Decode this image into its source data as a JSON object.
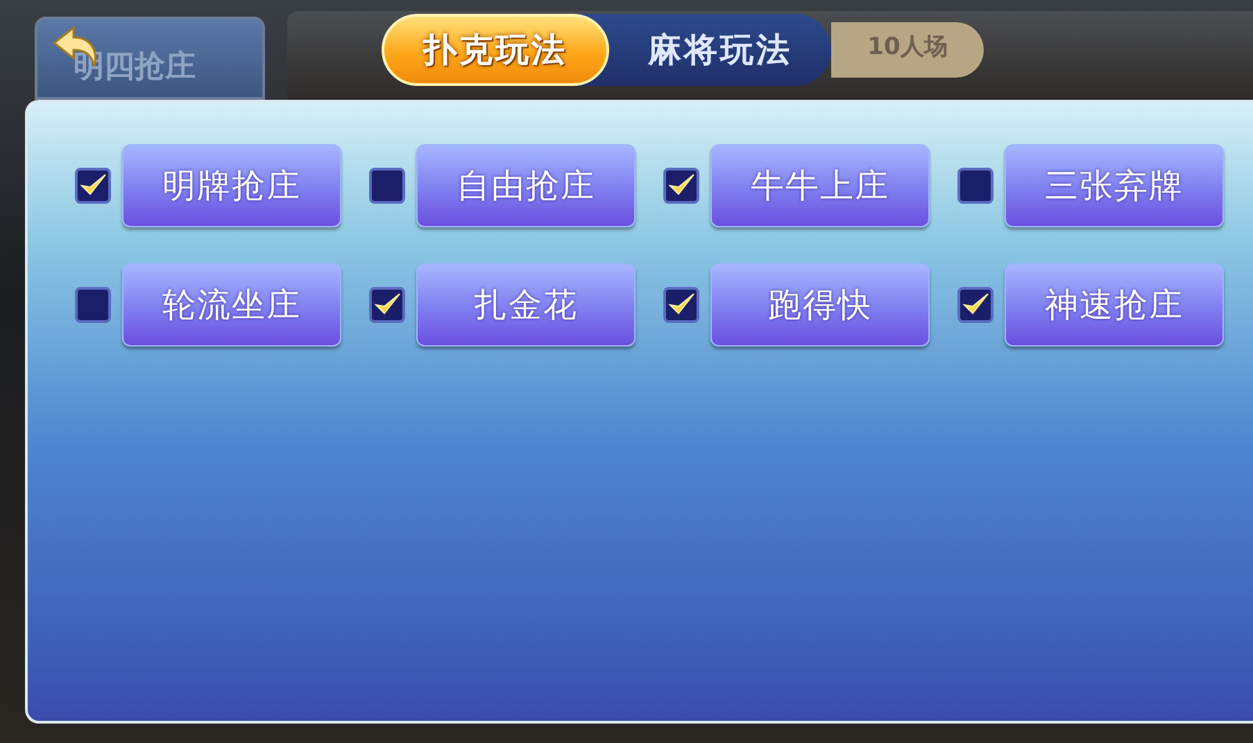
{
  "back_tab": {
    "label": "明四抢庄"
  },
  "mode_tabs": [
    {
      "label": "扑克玩法",
      "selected": true
    },
    {
      "label": "麻将玩法",
      "selected": false
    }
  ],
  "room_size": "10人场",
  "games": [
    {
      "label": "明牌抢庄",
      "checked": true
    },
    {
      "label": "自由抢庄",
      "checked": false
    },
    {
      "label": "牛牛上庄",
      "checked": true
    },
    {
      "label": "三张弃牌",
      "checked": false
    },
    {
      "label": "轮流坐庄",
      "checked": false
    },
    {
      "label": "扎金花",
      "checked": true
    },
    {
      "label": "跑得快",
      "checked": true
    },
    {
      "label": "神速抢庄",
      "checked": true
    }
  ]
}
